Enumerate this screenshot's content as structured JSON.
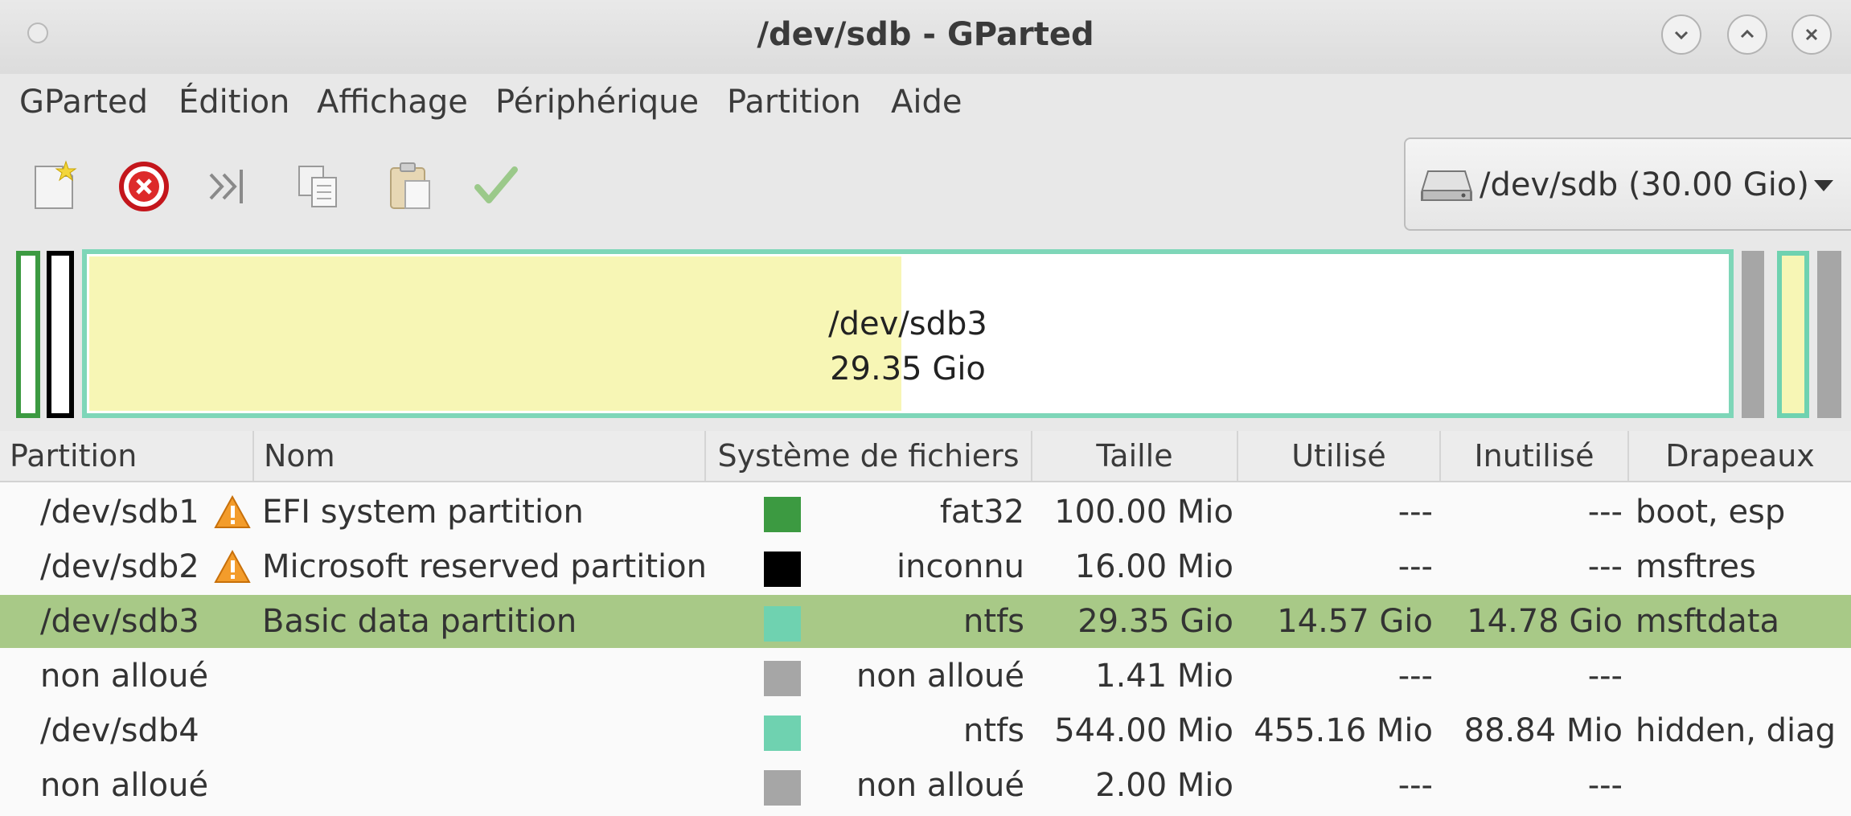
{
  "window": {
    "title": "/dev/sdb - GParted"
  },
  "menu": [
    "GParted",
    "Édition",
    "Affichage",
    "Périphérique",
    "Partition",
    "Aide"
  ],
  "toolbar": {
    "icons": [
      "new-icon",
      "delete-icon",
      "resize-move-icon",
      "copy-icon",
      "paste-icon",
      "apply-icon"
    ],
    "device_selector": "/dev/sdb (30.00 Gio)"
  },
  "disk_map": {
    "selected_label": "/dev/sdb3",
    "selected_size": "29.35 Gio",
    "selected_used_fraction": 0.496
  },
  "table": {
    "columns": [
      "Partition",
      "Nom",
      "Système de fichiers",
      "Taille",
      "Utilisé",
      "Inutilisé",
      "Drapeaux"
    ],
    "rows": [
      {
        "partition": "/dev/sdb1",
        "warning": true,
        "name": "EFI system partition",
        "fs_color": "#3c9a41",
        "filesystem": "fat32",
        "size": "100.00 Mio",
        "used": "---",
        "unused": "---",
        "flags": "boot, esp",
        "selected": false
      },
      {
        "partition": "/dev/sdb2",
        "warning": true,
        "name": "Microsoft reserved partition",
        "fs_color": "#000000",
        "filesystem": "inconnu",
        "size": "16.00 Mio",
        "used": "---",
        "unused": "---",
        "flags": "msftres",
        "selected": false
      },
      {
        "partition": "/dev/sdb3",
        "warning": false,
        "name": "Basic data partition",
        "fs_color": "#6fd2b0",
        "filesystem": "ntfs",
        "size": "29.35 Gio",
        "used": "14.57 Gio",
        "unused": "14.78 Gio",
        "flags": "msftdata",
        "selected": true
      },
      {
        "partition": "non alloué",
        "warning": false,
        "name": "",
        "fs_color": "#a6a6a6",
        "filesystem": "non alloué",
        "size": "1.41 Mio",
        "used": "---",
        "unused": "---",
        "flags": "",
        "selected": false
      },
      {
        "partition": "/dev/sdb4",
        "warning": false,
        "name": "",
        "fs_color": "#6fd2b0",
        "filesystem": "ntfs",
        "size": "544.00 Mio",
        "used": "455.16 Mio",
        "unused": "88.84 Mio",
        "flags": "hidden, diag",
        "selected": false
      },
      {
        "partition": "non alloué",
        "warning": false,
        "name": "",
        "fs_color": "#a6a6a6",
        "filesystem": "non alloué",
        "size": "2.00 Mio",
        "used": "---",
        "unused": "---",
        "flags": "",
        "selected": false
      }
    ]
  }
}
